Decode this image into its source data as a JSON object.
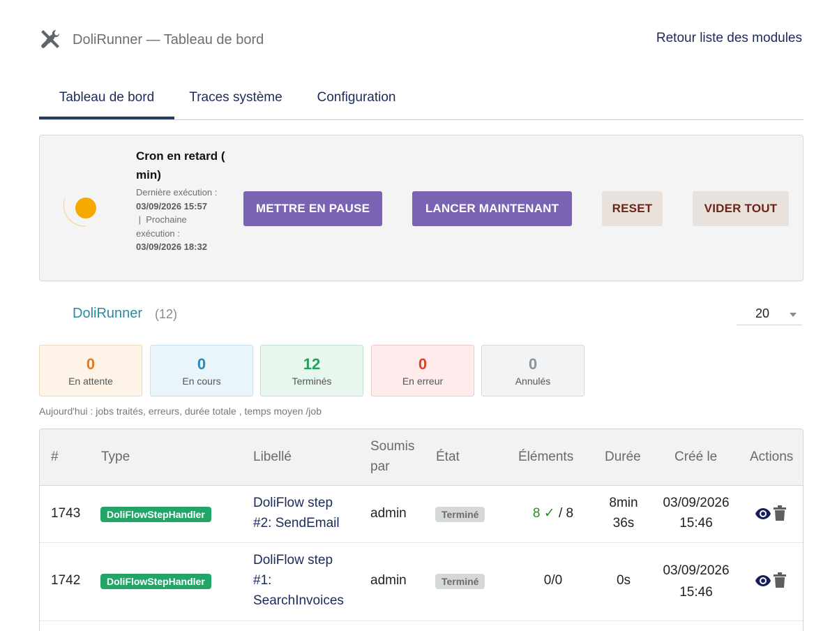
{
  "header": {
    "app_title": "DoliRunner — Tableau de bord",
    "back_link": "Retour liste des modules"
  },
  "tabs": [
    {
      "label": "Tableau de bord",
      "active": true
    },
    {
      "label": "Traces système",
      "active": false
    },
    {
      "label": "Configuration",
      "active": false
    }
  ],
  "cron": {
    "title": "Cron en retard ( min)",
    "last_label": "Dernière exécution :",
    "last_value": "03/09/2026 15:57",
    "separator": "|",
    "next_label": "Prochaine exécution :",
    "next_value": "03/09/2026 18:32",
    "buttons": {
      "pause": "METTRE EN PAUSE",
      "run_now": "LANCER MAINTENANT",
      "reset": "RESET",
      "clear_all": "VIDER TOUT"
    },
    "status_color": "#f5a800"
  },
  "section": {
    "title": "DoliRunner",
    "count": "(12)",
    "page_size": "20"
  },
  "stats": [
    {
      "value": "0",
      "label": "En attente",
      "color": "#e07b1e",
      "bg": "#fdf3e6",
      "border": "#efd9bb"
    },
    {
      "value": "0",
      "label": "En cours",
      "color": "#2c8ab8",
      "bg": "#eaf4fb",
      "border": "#c7dfee"
    },
    {
      "value": "12",
      "label": "Terminés",
      "color": "#25a05c",
      "bg": "#e8f7ee",
      "border": "#bfe3cc"
    },
    {
      "value": "0",
      "label": "En erreur",
      "color": "#d9432e",
      "bg": "#fdeceb",
      "border": "#efc8c3"
    },
    {
      "value": "0",
      "label": "Annulés",
      "color": "#8b9498",
      "bg": "#f2f3f4",
      "border": "#d6d9db"
    }
  ],
  "today_line": "Aujourd'hui : jobs traités, erreurs, durée totale , temps moyen /job",
  "table": {
    "headers": {
      "id": "#",
      "type": "Type",
      "label": "Libellé",
      "submitted_l1": "Soumis",
      "submitted_l2": "par",
      "state": "État",
      "elements": "Éléments",
      "duration": "Durée",
      "created": "Créé le",
      "actions": "Actions"
    },
    "rows": [
      {
        "id": "1743",
        "type": "DoliFlowStepHandler",
        "label_l1": "DoliFlow step",
        "label_l2": "#2: SendEmail",
        "label_l3": "",
        "submitted_by": "admin",
        "state": "Terminé",
        "elements_ok": "8 ✓",
        "elements_total": " / 8",
        "duration_l1": "8min",
        "duration_l2": "36s",
        "created_l1": "03/09/2026",
        "created_l2": "15:46"
      },
      {
        "id": "1742",
        "type": "DoliFlowStepHandler",
        "label_l1": "DoliFlow step",
        "label_l2": "#1:",
        "label_l3": "SearchInvoices",
        "submitted_by": "admin",
        "state": "Terminé",
        "elements_ok": "",
        "elements_total": "0/0",
        "duration_l1": "0s",
        "duration_l2": "",
        "created_l1": "03/09/2026",
        "created_l2": "15:46"
      }
    ]
  },
  "icons": {
    "app": "tools-icon",
    "view": "eye-icon",
    "delete": "trash-icon",
    "cron_status": "spinner-icon"
  }
}
